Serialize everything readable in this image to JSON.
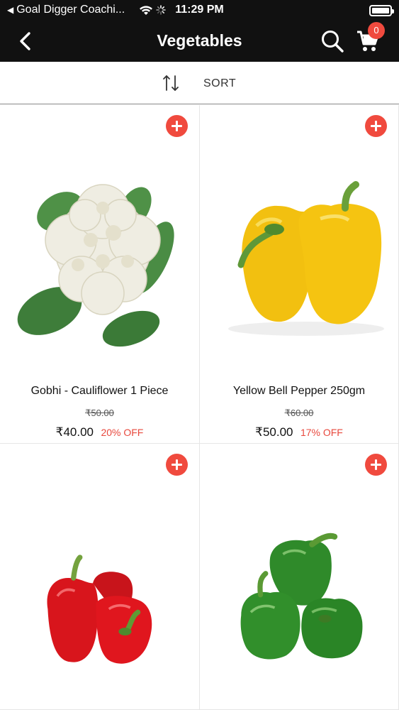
{
  "status": {
    "back_app": "Goal Digger Coachi...",
    "time": "11:29 PM"
  },
  "header": {
    "title": "Vegetables",
    "cart_count": "0"
  },
  "sort": {
    "label": "SORT"
  },
  "colors": {
    "accent": "#f04a3e",
    "header_bg": "#111111",
    "discount": "#e8483d"
  },
  "products": [
    {
      "name": "Gobhi - Cauliflower 1 Piece",
      "old_price": "₹50.00",
      "price": "₹40.00",
      "discount": "20% OFF",
      "image": "cauliflower"
    },
    {
      "name": "Yellow Bell Pepper 250gm",
      "old_price": "₹60.00",
      "price": "₹50.00",
      "discount": "17% OFF",
      "image": "yellow-bell-pepper"
    },
    {
      "name": "",
      "old_price": "",
      "price": "",
      "discount": "",
      "image": "red-bell-pepper"
    },
    {
      "name": "",
      "old_price": "",
      "price": "",
      "discount": "",
      "image": "green-bell-pepper"
    }
  ]
}
